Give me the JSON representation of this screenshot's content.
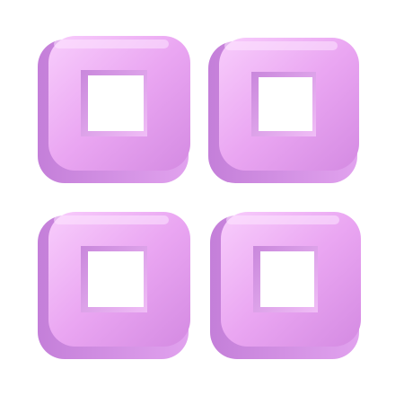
{
  "icon": {
    "name": "grid-icon",
    "tiles": [
      {
        "name": "grid-tile-top-left"
      },
      {
        "name": "grid-tile-top-right"
      },
      {
        "name": "grid-tile-bottom-left"
      },
      {
        "name": "grid-tile-bottom-right"
      }
    ]
  },
  "colors": {
    "face_light": "#f6c7fb",
    "face_mid": "#e9a2f0",
    "face_dark": "#d58ae3",
    "side": "#c985dc",
    "inner_wall": "#dc95ea",
    "highlight": "#fde6ff",
    "background": "#ffffff"
  }
}
